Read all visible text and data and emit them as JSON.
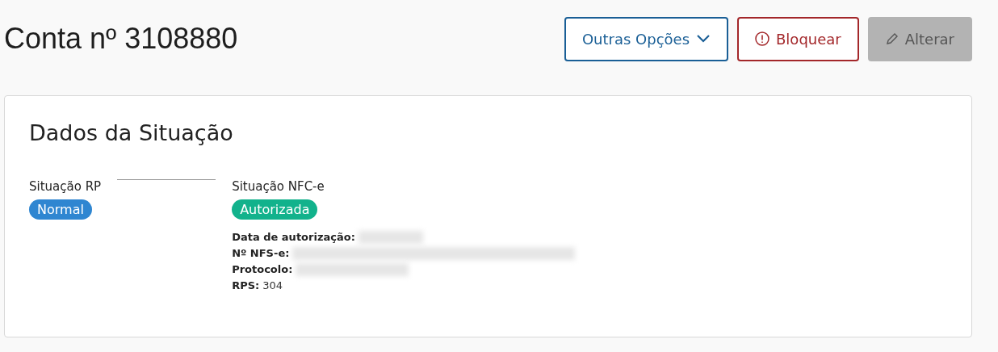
{
  "page": {
    "title": "Conta nº 3108880"
  },
  "actions": [
    {
      "label": "Outras Opções",
      "kind": "dropdown",
      "disabled": false
    },
    {
      "label": "Bloquear",
      "kind": "danger",
      "disabled": false
    },
    {
      "label": "Alterar",
      "kind": "edit",
      "disabled": true
    }
  ],
  "card": {
    "title": "Dados da Situação",
    "steps": [
      {
        "label": "Situação RP",
        "badge": "Normal",
        "color": "#2f86d1"
      },
      {
        "label": "Situação NFC-e",
        "badge": "Autorizada",
        "color": "#12b28c",
        "details": [
          {
            "label": "Data de autorização:",
            "redacted": true
          },
          {
            "label": "Nº NFS-e:",
            "redacted": true
          },
          {
            "label": "Protocolo:",
            "redacted": true
          },
          {
            "label": "RPS:",
            "value": "304",
            "redacted": false
          }
        ]
      }
    ]
  }
}
